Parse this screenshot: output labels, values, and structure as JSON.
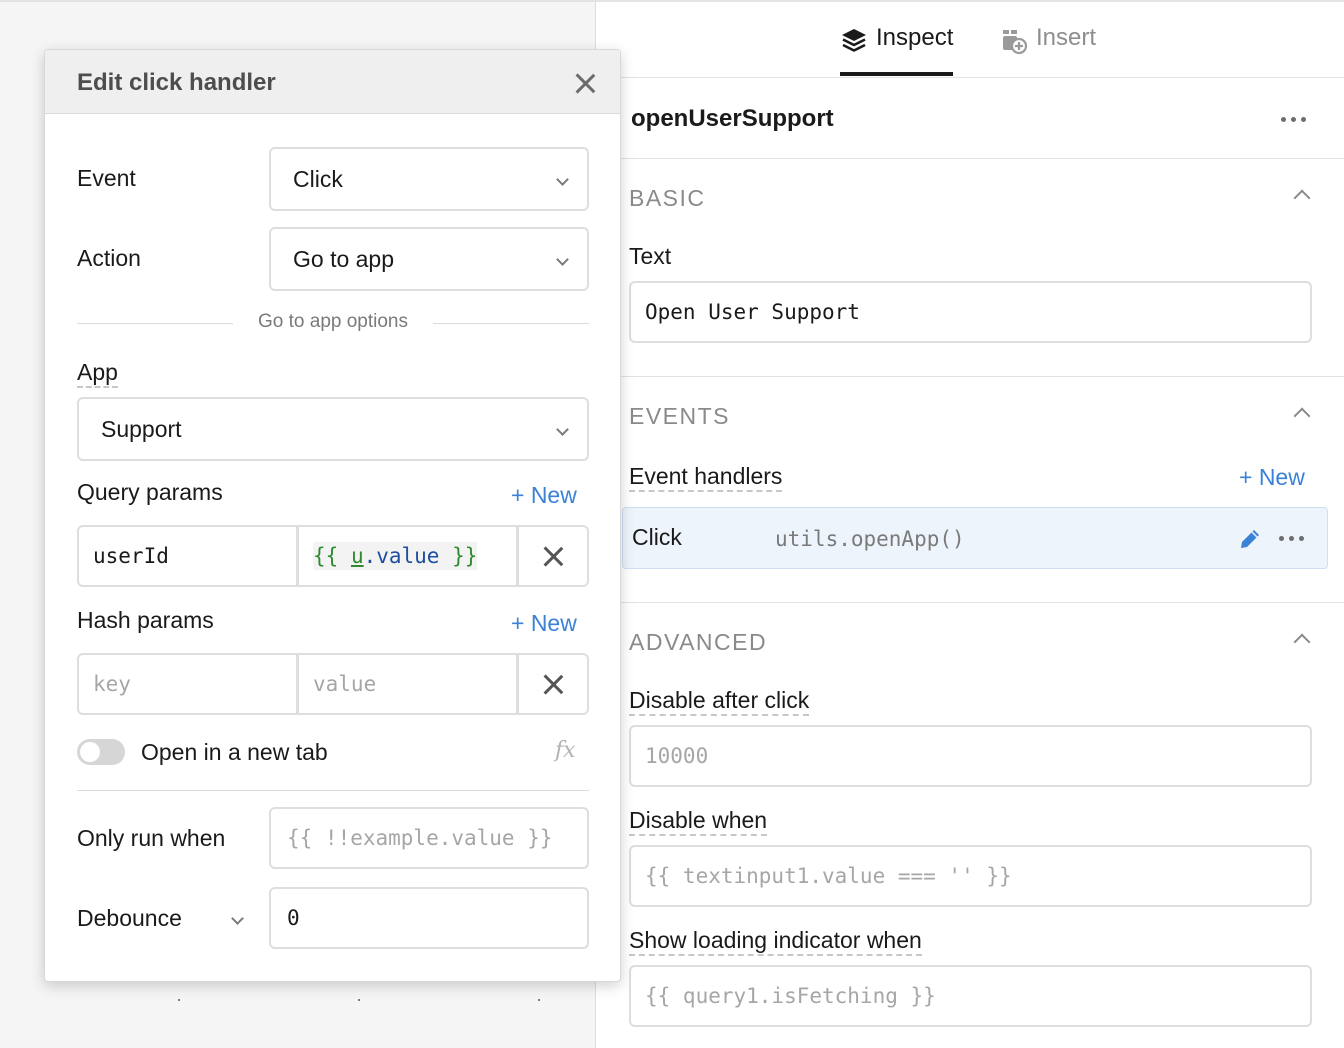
{
  "tabs": [
    {
      "label": "Inspect",
      "icon": "layers-icon",
      "active": true
    },
    {
      "label": "Insert",
      "icon": "insert-component-icon",
      "active": false
    }
  ],
  "inspector": {
    "component_name": "openUserSupport",
    "basic": {
      "title": "BASIC",
      "text_label": "Text",
      "text_value": "Open User Support"
    },
    "events": {
      "title": "EVENTS",
      "handlers_label": "Event handlers",
      "new_label": "+ New",
      "handler": {
        "event": "Click",
        "action": "utils.openApp()"
      }
    },
    "advanced": {
      "title": "ADVANCED",
      "disable_after_click_label": "Disable after click",
      "disable_after_click_placeholder": "10000",
      "disable_when_label": "Disable when",
      "disable_when_placeholder": "{{ textinput1.value === '' }}",
      "loading_label": "Show loading indicator when",
      "loading_placeholder": "{{ query1.isFetching }}"
    }
  },
  "modal": {
    "title": "Edit click handler",
    "event_label": "Event",
    "event_value": "Click",
    "action_label": "Action",
    "action_value": "Go to app",
    "options_label": "Go to app options",
    "app_label": "App",
    "app_value": "Support",
    "query_params_label": "Query params",
    "query_new": "+ New",
    "query_params": [
      {
        "key": "userId",
        "value_open": "{{ ",
        "value_var": "u",
        "value_prop": ".value",
        "value_close": " }}"
      }
    ],
    "hash_params_label": "Hash params",
    "hash_new": "+ New",
    "hash_key_placeholder": "key",
    "hash_value_placeholder": "value",
    "new_tab_label": "Open in a new tab",
    "fx_label": "fx",
    "only_run_label": "Only run when",
    "only_run_placeholder": "{{ !!example.value }}",
    "debounce_label": "Debounce",
    "debounce_value": "0"
  },
  "colors": {
    "accent_blue": "#3b82d6",
    "selected_row_bg": "#eef4fc",
    "code_green": "#2e8b2e"
  }
}
